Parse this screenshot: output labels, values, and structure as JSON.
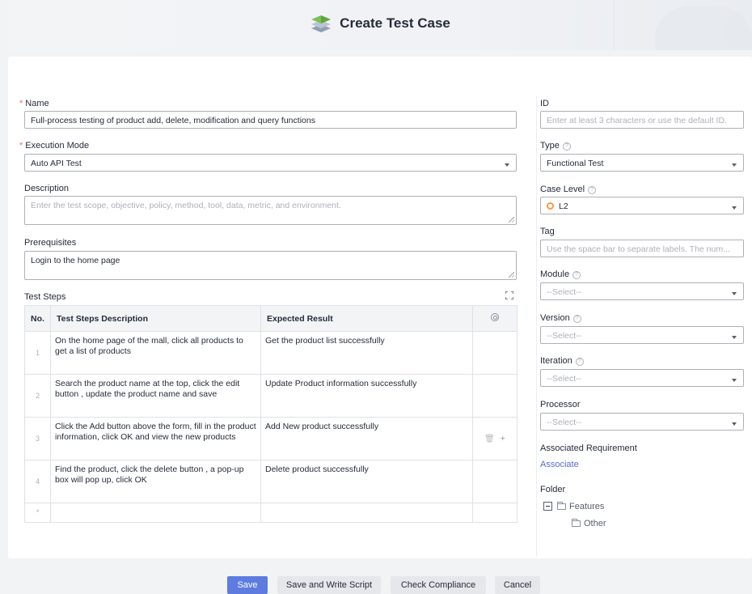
{
  "header": {
    "title": "Create Test Case",
    "icon": "layers-icon"
  },
  "form": {
    "name": {
      "label": "Name",
      "required_mark": "*",
      "value": "Full-process testing of product add, delete, modification and query functions"
    },
    "execution_mode": {
      "label": "Execution Mode",
      "required_mark": "*",
      "value": "Auto API Test"
    },
    "description": {
      "label": "Description",
      "placeholder": "Enter the test scope, objective, policy, method, tool, data, metric, and environment."
    },
    "prerequisites": {
      "label": "Prerequisites",
      "value": "Login to the home page"
    },
    "test_steps": {
      "label": "Test Steps",
      "columns": {
        "no": "No.",
        "description": "Test Steps Description",
        "expected": "Expected Result"
      },
      "rows": [
        {
          "no": "1",
          "description": "On the home page of the mall, click all products to get a list of products",
          "expected": "Get the product list successfully"
        },
        {
          "no": "2",
          "description": "Search the product name  at the top, click the edit button , update the product name and save",
          "expected": "Update Product information successfully"
        },
        {
          "no": "3",
          "description": "Click the Add button above the form, fill in the product information, click OK and view the new products",
          "expected": "Add New product  successfully"
        },
        {
          "no": "4",
          "description": "Find the product, click the delete button , a pop-up box will pop up, click OK",
          "expected": "Delete product successfully"
        }
      ],
      "new_row_marker": "*",
      "row_actions": {
        "delete": "🗑",
        "add": "+"
      }
    }
  },
  "sidebar": {
    "id": {
      "label": "ID",
      "placeholder": "Enter at least 3 characters or use the default ID."
    },
    "type": {
      "label": "Type",
      "value": "Functional Test"
    },
    "case_level": {
      "label": "Case Level",
      "value": "L2",
      "color": "#fa9841"
    },
    "tag": {
      "label": "Tag",
      "placeholder": "Use the space bar to separate labels. The num..."
    },
    "module": {
      "label": "Module",
      "value": "--Select--"
    },
    "version": {
      "label": "Version",
      "value": "--Select--"
    },
    "iteration": {
      "label": "Iteration",
      "value": "--Select--"
    },
    "processor": {
      "label": "Processor",
      "value": "--Select--"
    },
    "associated_requirement": {
      "label": "Associated Requirement",
      "link": "Associate"
    },
    "folder": {
      "label": "Folder",
      "root": "Features",
      "child": "Other"
    }
  },
  "footer": {
    "save": "Save",
    "save_write_script": "Save and Write Script",
    "check_compliance": "Check Compliance",
    "cancel": "Cancel"
  },
  "help_glyph": "?",
  "colors": {
    "primary": "#5e7ce0",
    "required": "#f66f6a",
    "link": "#526ecc"
  }
}
